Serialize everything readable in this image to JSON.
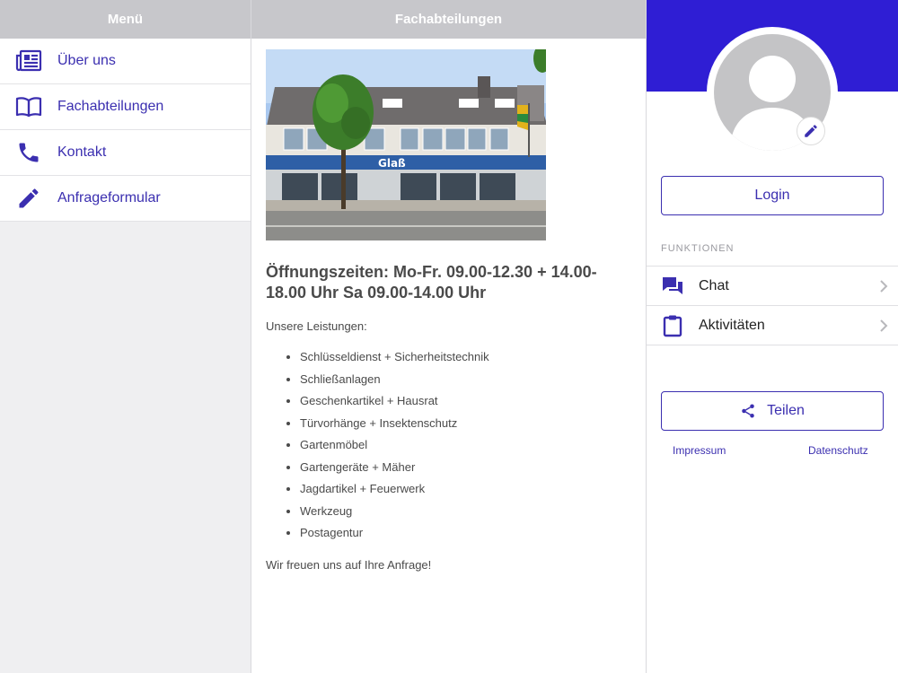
{
  "menu": {
    "title": "Menü",
    "items": [
      {
        "label": "Über uns",
        "icon": "newspaper-icon"
      },
      {
        "label": "Fachabteilungen",
        "icon": "book-icon"
      },
      {
        "label": "Kontakt",
        "icon": "phone-icon"
      },
      {
        "label": "Anfrageformular",
        "icon": "pencil-icon"
      }
    ]
  },
  "content": {
    "title": "Fachabteilungen",
    "photo_sign": "Glaß",
    "hours": "Öffnungszeiten: Mo-Fr. 09.00-12.30 + 14.00-18.00 Uhr   Sa 09.00-14.00 Uhr",
    "services_intro": "Unsere Leistungen:",
    "services": [
      "Schlüsseldienst + Sicherheitstechnik",
      "Schließanlagen",
      "Geschenkartikel + Hausrat",
      "Türvorhänge + Insektenschutz",
      "Gartenmöbel",
      "Gartengeräte + Mäher",
      "Jagdartikel + Feuerwerk",
      "Werkzeug",
      "Postagentur"
    ],
    "closing": "Wir freuen uns auf Ihre Anfrage!"
  },
  "profile": {
    "login_label": "Login",
    "functions_label": "FUNKTIONEN",
    "functions": [
      {
        "label": "Chat",
        "icon": "chat-icon"
      },
      {
        "label": "Aktivitäten",
        "icon": "clipboard-icon"
      }
    ],
    "share_label": "Teilen",
    "impressum_label": "Impressum",
    "datenschutz_label": "Datenschutz"
  },
  "colors": {
    "accent": "#3b2fb0",
    "banner": "#2f1ed4",
    "header_gray": "#c7c7cb"
  }
}
